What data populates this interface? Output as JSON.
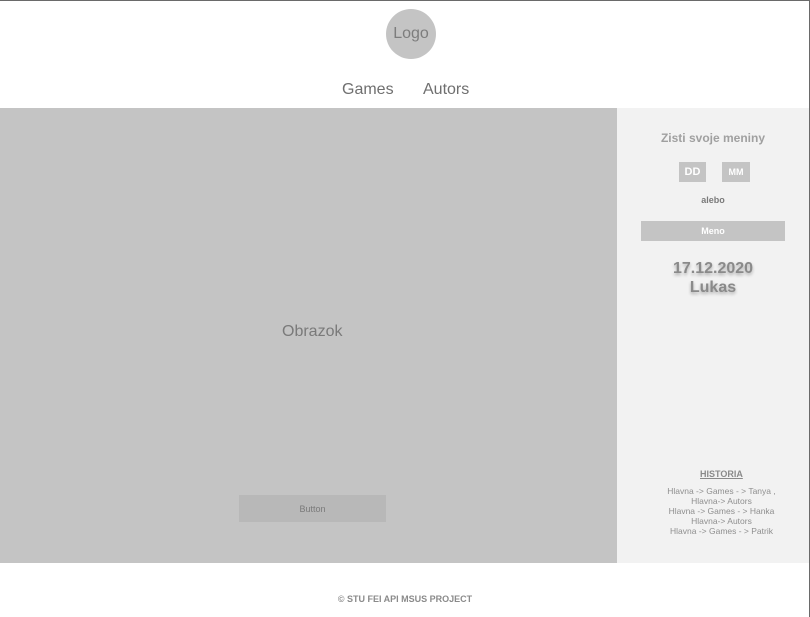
{
  "header": {
    "logo_text": "Logo"
  },
  "nav": {
    "items": [
      {
        "label": "Games"
      },
      {
        "label": "Autors"
      }
    ]
  },
  "main": {
    "image_label": "Obrazok",
    "button_label": "Button"
  },
  "sidebar": {
    "title": "Zisti svoje meniny",
    "day_placeholder": "DD",
    "month_placeholder": "MM",
    "or_text": "alebo",
    "name_placeholder": "Meno",
    "result_date": "17.12.2020",
    "result_name": "Lukas",
    "history_title": "HISTORIA",
    "history_lines": [
      "Hlavna -> Games - > Tanya ,",
      "Hlavna-> Autors",
      "Hlavna -> Games - > Hanka",
      "Hlavna-> Autors",
      "Hlavna -> Games - > Patrik"
    ]
  },
  "footer": {
    "text": "© STU FEI API MSUS PROJECT"
  },
  "colors": {
    "placeholder_gray": "#c4c4c4",
    "sidebar_bg": "#f2f2f2",
    "text_gray": "#7a7a7a"
  }
}
